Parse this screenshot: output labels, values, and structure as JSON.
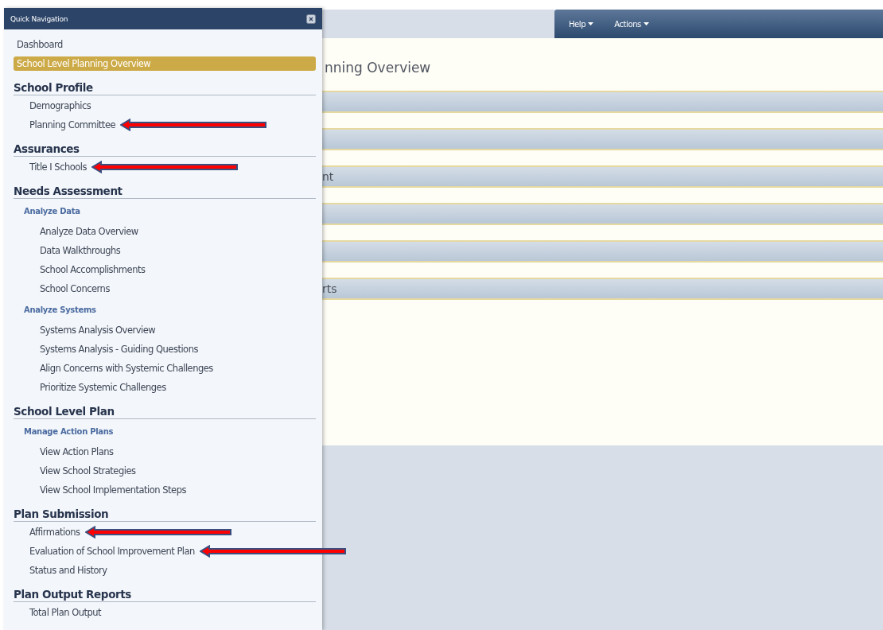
{
  "toolbar": {
    "menus": [
      {
        "label": "Help"
      },
      {
        "label": "Actions"
      }
    ]
  },
  "page": {
    "title": "nning Overview",
    "bars": [
      {
        "kind": "accordion"
      },
      {
        "kind": "accordion"
      },
      {
        "kind": "accordion",
        "label": "nt"
      },
      {
        "kind": "accordion"
      },
      {
        "kind": "accordion"
      },
      {
        "kind": "accordion",
        "label": "rts"
      }
    ]
  },
  "quick_navigation": {
    "title": "Quick Navigation",
    "items": [
      {
        "kind": "link",
        "label": "Dashboard",
        "selected": false,
        "arrow": false
      },
      {
        "kind": "link",
        "label": "School Level Planning Overview",
        "selected": true,
        "arrow": false
      },
      {
        "kind": "section",
        "label": "School Profile",
        "children": [
          {
            "kind": "link",
            "label": "Demographics",
            "selected": false,
            "arrow": false
          },
          {
            "kind": "link",
            "label": "Planning Committee",
            "selected": false,
            "arrow": true
          }
        ]
      },
      {
        "kind": "section",
        "label": "Assurances",
        "children": [
          {
            "kind": "link",
            "label": "Title I Schools",
            "selected": false,
            "arrow": true
          }
        ]
      },
      {
        "kind": "section",
        "label": "Needs Assessment",
        "children": [
          {
            "kind": "group",
            "label": "Analyze Data",
            "children": [
              {
                "label": "Analyze Data Overview",
                "selected": false,
                "arrow": false
              },
              {
                "label": "Data Walkthroughs",
                "selected": false,
                "arrow": false
              },
              {
                "label": "School Accomplishments",
                "selected": false,
                "arrow": false
              },
              {
                "label": "School Concerns",
                "selected": false,
                "arrow": false
              }
            ]
          },
          {
            "kind": "group",
            "label": "Analyze Systems",
            "children": [
              {
                "label": "Systems Analysis Overview",
                "selected": false,
                "arrow": false
              },
              {
                "label": "Systems Analysis - Guiding Questions",
                "selected": false,
                "arrow": false
              },
              {
                "label": "Align Concerns with Systemic Challenges",
                "selected": false,
                "arrow": false
              },
              {
                "label": "Prioritize Systemic Challenges",
                "selected": false,
                "arrow": false
              }
            ]
          }
        ]
      },
      {
        "kind": "section",
        "label": "School Level Plan",
        "children": [
          {
            "kind": "group",
            "label": "Manage Action Plans",
            "children": [
              {
                "label": "View Action Plans",
                "selected": false,
                "arrow": false
              },
              {
                "label": "View School Strategies",
                "selected": false,
                "arrow": false
              },
              {
                "label": "View School Implementation Steps",
                "selected": false,
                "arrow": false
              }
            ]
          }
        ]
      },
      {
        "kind": "section",
        "label": "Plan Submission",
        "children": [
          {
            "kind": "link",
            "label": "Affirmations",
            "selected": false,
            "arrow": true
          },
          {
            "kind": "link",
            "label": "Evaluation of School Improvement Plan",
            "selected": false,
            "arrow": true
          },
          {
            "kind": "link",
            "label": "Status and History",
            "selected": false,
            "arrow": false
          }
        ]
      },
      {
        "kind": "section",
        "label": "Plan Output Reports",
        "children": [
          {
            "kind": "link",
            "label": "Total Plan Output",
            "selected": false,
            "arrow": false
          }
        ]
      }
    ]
  }
}
